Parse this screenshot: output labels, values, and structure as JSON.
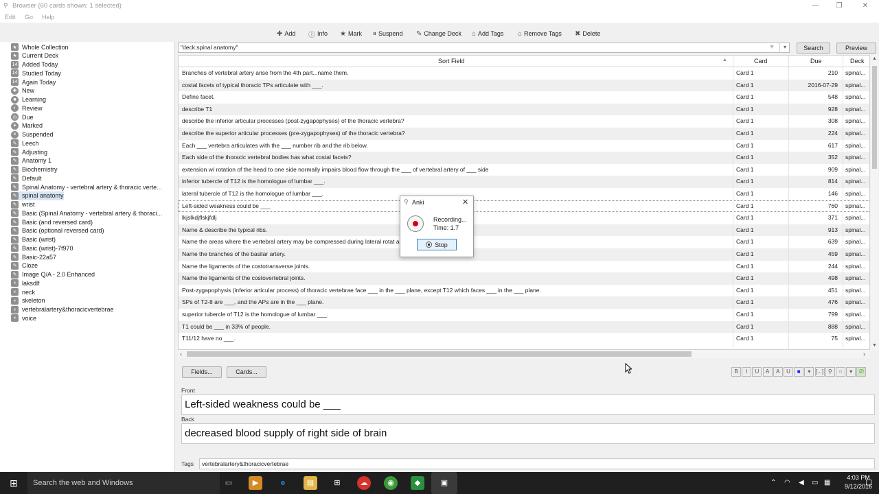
{
  "window": {
    "title": "Browser (60 cards shown; 1 selected)",
    "menu": [
      "Edit",
      "Go",
      "Help"
    ]
  },
  "toolbar": [
    {
      "label": "Add",
      "icon": "add-icon"
    },
    {
      "label": "Info",
      "icon": "info-icon"
    },
    {
      "label": "Mark",
      "icon": "star-icon"
    },
    {
      "label": "Suspend",
      "icon": "pause-icon"
    },
    {
      "label": "Change Deck",
      "icon": "deck-icon"
    },
    {
      "label": "Add Tags",
      "icon": "tag-icon"
    },
    {
      "label": "Remove Tags",
      "icon": "tag-icon"
    },
    {
      "label": "Delete",
      "icon": "delete-icon"
    }
  ],
  "sidebar": {
    "items": [
      "Whole Collection",
      "Current Deck",
      "Added Today",
      "Studied Today",
      "Again Today",
      "New",
      "Learning",
      "Review",
      "Due",
      "Marked",
      "Suspended",
      "Leech",
      "Adjusting",
      "Anatomy 1",
      "Biochemistry",
      "Default",
      "Spinal Anatomy - vertebral artery & thoracic verte...",
      "spinal anatomy",
      "wrist",
      "Basic (Spinal Anatomy - vertebral artery & thoraci...",
      "Basic (and reversed card)",
      "Basic (optional reversed card)",
      "Basic (wrist)",
      "Basic (wrist)-7f970",
      "Basic-22a57",
      "Cloze",
      "Image Q/A - 2.0 Enhanced",
      "laksdlf",
      "neck",
      "skeleton",
      "vertebralartery&thoracicvertebrae",
      "voice"
    ]
  },
  "search": {
    "query": "\"deck:spinal anatomy\"",
    "search_label": "Search",
    "preview_label": "Preview"
  },
  "table": {
    "headers": {
      "sort": "Sort Field",
      "card": "Card",
      "due": "Due",
      "deck": "Deck"
    },
    "rows": [
      {
        "sort": "Branches of vertebral artery arise from the 4th part...name them.",
        "card": "Card 1",
        "due": "210",
        "deck": "spinal..."
      },
      {
        "sort": "costal facets of typical thoracic TPs articulate with ___.",
        "card": "Card 1",
        "due": "2016-07-29",
        "deck": "spinal..."
      },
      {
        "sort": "Define facet.",
        "card": "Card 1",
        "due": "548",
        "deck": "spinal..."
      },
      {
        "sort": "describe T1",
        "card": "Card 1",
        "due": "928",
        "deck": "spinal..."
      },
      {
        "sort": "describe the inferior articular processes (post-zygapophyses) of the thoracic vertebra?",
        "card": "Card 1",
        "due": "308",
        "deck": "spinal..."
      },
      {
        "sort": "describe the superior articular processes (pre-zygapophyses) of the thoracic vertebra?",
        "card": "Card 1",
        "due": "224",
        "deck": "spinal..."
      },
      {
        "sort": "Each ___ vertebra articulates with the ___ number rib and the rib below.",
        "card": "Card 1",
        "due": "617",
        "deck": "spinal..."
      },
      {
        "sort": "Each side of the thoracic vertebral bodies has what costal facets?",
        "card": "Card 1",
        "due": "352",
        "deck": "spinal..."
      },
      {
        "sort": "extension w/ rotation of the head to one side normally impairs blood flow through the ___ of vertebral artery of ___ side",
        "card": "Card 1",
        "due": "909",
        "deck": "spinal..."
      },
      {
        "sort": "inferior tubercle of T12 is the homologue of lumbar ___.",
        "card": "Card 1",
        "due": "814",
        "deck": "spinal..."
      },
      {
        "sort": "lateral tubercle of T12 is the homologue of lumbar ___.",
        "card": "Card 1",
        "due": "146",
        "deck": "spinal..."
      },
      {
        "sort": "Left-sided weakness could be ___",
        "card": "Card 1",
        "due": "760",
        "deck": "spinal..."
      },
      {
        "sort": "lkjslkdjflskjfdlj",
        "card": "Card 1",
        "due": "371",
        "deck": "spinal..."
      },
      {
        "sort": "Name & describe the typical ribs.",
        "card": "Card 1",
        "due": "913",
        "deck": "spinal..."
      },
      {
        "sort": "Name the areas where the vertebral artery may be compressed during lateral rotat                                  ad.",
        "card": "Card 1",
        "due": "639",
        "deck": "spinal..."
      },
      {
        "sort": "Name the branches of the basilar artery.",
        "card": "Card 1",
        "due": "459",
        "deck": "spinal..."
      },
      {
        "sort": "Name the ligaments of the costotransverse joints.",
        "card": "Card 1",
        "due": "244",
        "deck": "spinal..."
      },
      {
        "sort": "Name the ligaments of the costovertebral joints.",
        "card": "Card 1",
        "due": "498",
        "deck": "spinal..."
      },
      {
        "sort": "Post-zygapophysis (inferior articular process) of thoracic vertebrae face ___ in the ___ plane, except T12 which faces ___ in the ___ plane.",
        "card": "Card 1",
        "due": "451",
        "deck": "spinal..."
      },
      {
        "sort": "SPs of T2-8 are ___, and the APs are in the ___ plane.",
        "card": "Card 1",
        "due": "476",
        "deck": "spinal..."
      },
      {
        "sort": "superior tubercle of T12 is the homologue of lumbar ___.",
        "card": "Card 1",
        "due": "799",
        "deck": "spinal..."
      },
      {
        "sort": "T1 could be ___ in 33% of people.",
        "card": "Card 1",
        "due": "888",
        "deck": "spinal..."
      },
      {
        "sort": "T11/12 have no ___.",
        "card": "Card 1",
        "due": "75",
        "deck": "spinal..."
      }
    ],
    "selected_index": 11
  },
  "editor": {
    "fields_btn": "Fields...",
    "cards_btn": "Cards...",
    "front_label": "Front",
    "front_value": "Left-sided weakness could be ___",
    "back_label": "Back",
    "back_value": "decreased blood supply of right side of brain",
    "tags_label": "Tags",
    "tags_value": "vertebralartery&thoracicvertebrae",
    "format_buttons": [
      "B",
      "I",
      "U",
      "A",
      "A",
      "U",
      "■",
      "▾",
      "[...]",
      "⚲",
      "○",
      "▾",
      "⎚"
    ]
  },
  "dialog": {
    "title": "Anki",
    "status": "Recording...",
    "time": "Time: 1.7",
    "stop_label": "Stop"
  },
  "taskbar": {
    "search_placeholder": "Search the web and Windows",
    "time": "4:03 PM",
    "date": "9/12/2016"
  },
  "colors": {
    "selection": "#d8e6f5",
    "record_red": "#d0021b",
    "taskbar": "#1f1f1f"
  }
}
